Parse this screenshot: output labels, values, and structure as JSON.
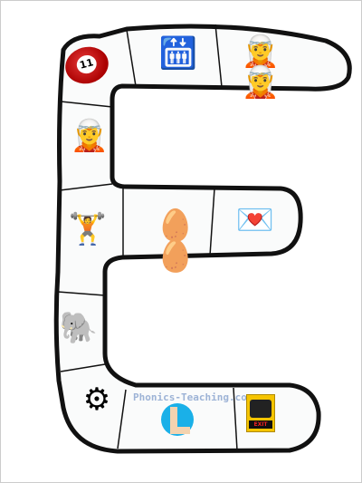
{
  "worksheet": {
    "letter": "E",
    "watermark": "Phonics-Teaching.com",
    "pictures": [
      {
        "name": "billiard-ball",
        "label": "11"
      },
      {
        "name": "elevator"
      },
      {
        "name": "elves"
      },
      {
        "name": "elf"
      },
      {
        "name": "exercise"
      },
      {
        "name": "eggs"
      },
      {
        "name": "envelope"
      },
      {
        "name": "elephant"
      },
      {
        "name": "engine"
      },
      {
        "name": "elbow"
      },
      {
        "name": "exit",
        "label": "EXIT"
      }
    ],
    "colors": {
      "outline": "#111111",
      "fill": "#fafbfb",
      "exit_sign": "#f5c400",
      "elbow_bg": "#1ab0e8",
      "watermark": "#9db3d6"
    }
  }
}
